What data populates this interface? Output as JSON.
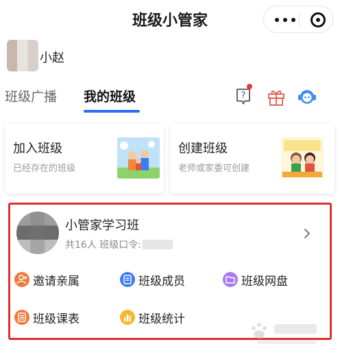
{
  "header": {
    "title": "班级小管家"
  },
  "user": {
    "name": "小赵"
  },
  "tabs": [
    {
      "label": "班级广播",
      "active": false
    },
    {
      "label": "我的班级",
      "active": true
    }
  ],
  "header_icons": [
    "help-icon",
    "gift-icon",
    "customer-service-icon"
  ],
  "cards": [
    {
      "title": "加入班级",
      "subtitle": "已经存在的班级"
    },
    {
      "title": "创建班级",
      "subtitle": "老师或家委可创建"
    }
  ],
  "class": {
    "name": "小管家学习班",
    "info": "共16人  班级口令:",
    "actions": [
      {
        "label": "邀请亲属",
        "icon": "person-add-icon",
        "color": "#f07a3a"
      },
      {
        "label": "班级成员",
        "icon": "members-icon",
        "color": "#3d7df3"
      },
      {
        "label": "班级网盘",
        "icon": "folder-icon",
        "color": "#a77cf0"
      },
      {
        "label": "班级课表",
        "icon": "schedule-icon",
        "color": "#f07a3a"
      },
      {
        "label": "班级统计",
        "icon": "stats-icon",
        "color": "#f4b731"
      }
    ]
  },
  "colors": {
    "accent": "#2f6df6",
    "highlight_border": "#e02d2d",
    "badge": "#e53935"
  }
}
